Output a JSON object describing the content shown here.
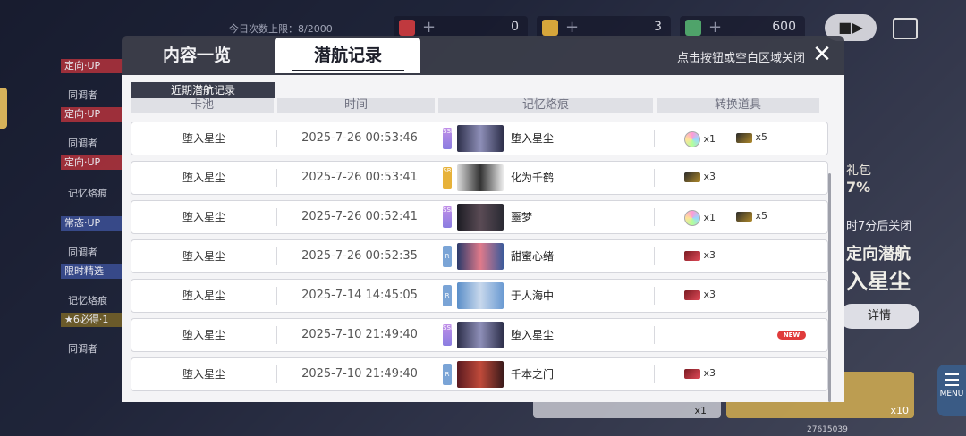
{
  "background": {
    "daily_limit": "今日次数上限：8/2000",
    "resources": [
      {
        "name": "ticket-a",
        "value": "0",
        "color": "#c0393e"
      },
      {
        "name": "ticket-b",
        "value": "3",
        "color": "#d6a63b"
      },
      {
        "name": "ticket-c",
        "value": "600",
        "color": "#4fa36a"
      }
    ],
    "side_tags": [
      {
        "label": "定向·UP",
        "style": "red"
      },
      {
        "label": "同调者",
        "style": "plain"
      },
      {
        "label": "定向·UP",
        "style": "red"
      },
      {
        "label": "同调者",
        "style": "plain"
      },
      {
        "label": "定向·UP",
        "style": "red"
      },
      {
        "label": "记忆烙痕",
        "style": "plain"
      },
      {
        "label": "常态·UP",
        "style": "blue"
      },
      {
        "label": "同调者",
        "style": "plain"
      },
      {
        "label": "限时精选",
        "style": "blue"
      },
      {
        "label": "记忆烙痕",
        "style": "plain"
      },
      {
        "label": "★6必得·1",
        "style": "gold"
      },
      {
        "label": "同调者",
        "style": "plain"
      }
    ],
    "gift_label": "礼包",
    "gift_discount": "7%",
    "close_countdown": "时7分后关闭",
    "pool_title_line1": "定向潜航",
    "pool_title_line2": "入星尘",
    "detail_button": "详情",
    "menu_label": "MENU",
    "single_count": "x1",
    "ten_count": "x10",
    "uid": "27615039"
  },
  "modal": {
    "tabs": [
      {
        "label": "内容一览",
        "active": false
      },
      {
        "label": "潜航记录",
        "active": true
      }
    ],
    "close_hint": "点击按钮或空白区域关闭",
    "close_icon": "✕",
    "section_title": "近期潜航记录",
    "columns": [
      "卡池",
      "时间",
      "记忆烙痕",
      "转换道具"
    ],
    "rows": [
      {
        "pool": "堕入星尘",
        "time": "2025-7-26   00:53:46",
        "rarity": "SSR",
        "memory": "堕入星尘",
        "items": [
          {
            "icon": "rainbow-orb",
            "count": "x1"
          },
          {
            "icon": "gold-ticket",
            "count": "x5"
          }
        ],
        "new": false
      },
      {
        "pool": "堕入星尘",
        "time": "2025-7-26   00:53:41",
        "rarity": "SR",
        "memory": "化为千鹤",
        "items": [
          {
            "icon": "gold-ticket",
            "count": "x3"
          }
        ],
        "new": false
      },
      {
        "pool": "堕入星尘",
        "time": "2025-7-26   00:52:41",
        "rarity": "SSR",
        "memory": "噩梦",
        "items": [
          {
            "icon": "rainbow-orb",
            "count": "x1"
          },
          {
            "icon": "gold-ticket",
            "count": "x5"
          }
        ],
        "new": false
      },
      {
        "pool": "堕入星尘",
        "time": "2025-7-26   00:52:35",
        "rarity": "R",
        "memory": "甜蜜心绪",
        "items": [
          {
            "icon": "red-ticket",
            "count": "x3"
          }
        ],
        "new": false
      },
      {
        "pool": "堕入星尘",
        "time": "2025-7-14   14:45:05",
        "rarity": "R",
        "memory": "于人海中",
        "items": [
          {
            "icon": "red-ticket",
            "count": "x3"
          }
        ],
        "new": false
      },
      {
        "pool": "堕入星尘",
        "time": "2025-7-10   21:49:40",
        "rarity": "SSR",
        "memory": "堕入星尘",
        "items": [],
        "new": true,
        "new_label": "NEW"
      },
      {
        "pool": "堕入星尘",
        "time": "2025-7-10   21:49:40",
        "rarity": "R",
        "memory": "千本之门",
        "items": [
          {
            "icon": "red-ticket",
            "count": "x3"
          }
        ],
        "new": false
      }
    ]
  }
}
